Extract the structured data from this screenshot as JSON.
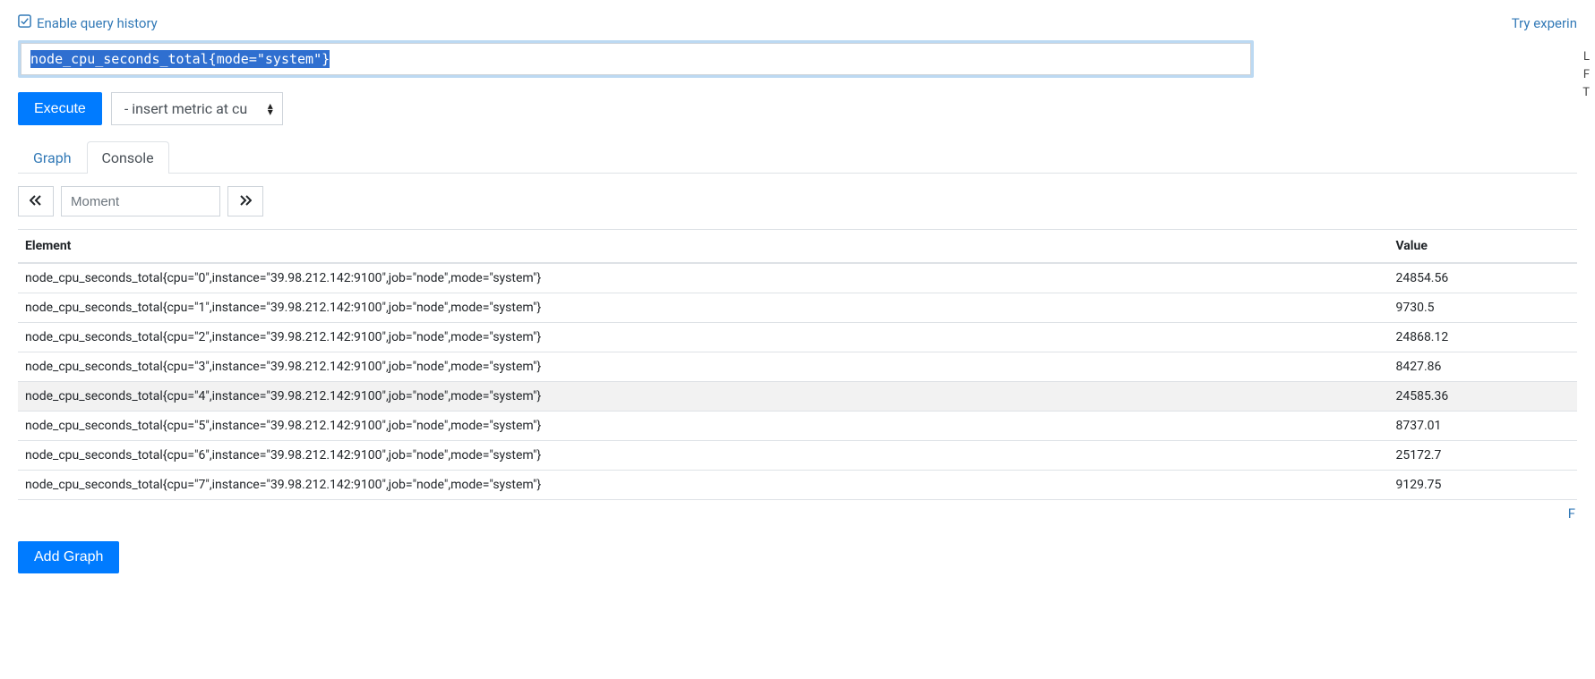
{
  "header": {
    "enable_history_label": "Enable query history",
    "try_experimental_label": "Try experin"
  },
  "right_edge_letters": [
    "L",
    "F",
    "T"
  ],
  "query": {
    "expression": "node_cpu_seconds_total{mode=\"system\"}"
  },
  "actions": {
    "execute_label": "Execute",
    "metric_select_placeholder": "- insert metric at cu"
  },
  "tabs": {
    "graph_label": "Graph",
    "console_label": "Console",
    "active": "console"
  },
  "moment": {
    "placeholder": "Moment"
  },
  "table": {
    "headers": {
      "element": "Element",
      "value": "Value"
    },
    "rows": [
      {
        "element": "node_cpu_seconds_total{cpu=\"0\",instance=\"39.98.212.142:9100\",job=\"node\",mode=\"system\"}",
        "value": "24854.56"
      },
      {
        "element": "node_cpu_seconds_total{cpu=\"1\",instance=\"39.98.212.142:9100\",job=\"node\",mode=\"system\"}",
        "value": "9730.5"
      },
      {
        "element": "node_cpu_seconds_total{cpu=\"2\",instance=\"39.98.212.142:9100\",job=\"node\",mode=\"system\"}",
        "value": "24868.12"
      },
      {
        "element": "node_cpu_seconds_total{cpu=\"3\",instance=\"39.98.212.142:9100\",job=\"node\",mode=\"system\"}",
        "value": "8427.86"
      },
      {
        "element": "node_cpu_seconds_total{cpu=\"4\",instance=\"39.98.212.142:9100\",job=\"node\",mode=\"system\"}",
        "value": "24585.36"
      },
      {
        "element": "node_cpu_seconds_total{cpu=\"5\",instance=\"39.98.212.142:9100\",job=\"node\",mode=\"system\"}",
        "value": "8737.01"
      },
      {
        "element": "node_cpu_seconds_total{cpu=\"6\",instance=\"39.98.212.142:9100\",job=\"node\",mode=\"system\"}",
        "value": "25172.7"
      },
      {
        "element": "node_cpu_seconds_total{cpu=\"7\",instance=\"39.98.212.142:9100\",job=\"node\",mode=\"system\"}",
        "value": "9129.75"
      }
    ],
    "hover_index": 4
  },
  "bottom_right_letter": "F",
  "add_graph": {
    "label": "Add Graph"
  }
}
